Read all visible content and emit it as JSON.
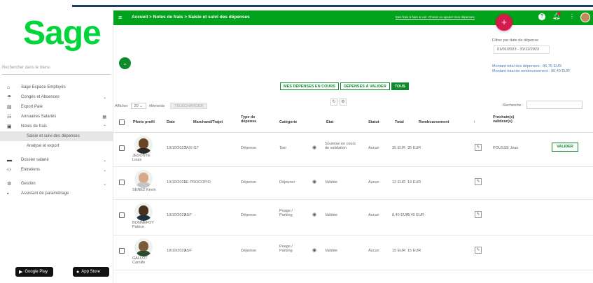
{
  "sidebar": {
    "logo": "Sage",
    "search_placeholder": "Rechercher dans le menu",
    "items": [
      {
        "label": "Sage Espace Employés",
        "icon": "home-icon",
        "glyph": "⌂",
        "chevron": ""
      },
      {
        "label": "Congés et Absences",
        "icon": "beach-icon",
        "glyph": "☂",
        "chevron": "⌄"
      },
      {
        "label": "Export Paie",
        "icon": "document-icon",
        "glyph": "▤",
        "chevron": ""
      },
      {
        "label": "Annuaires Salariés",
        "icon": "people-icon",
        "glyph": "☷",
        "chevron": "▦"
      },
      {
        "label": "Notes de frais",
        "icon": "receipt-icon",
        "glyph": "▣",
        "chevron": "⌃"
      },
      {
        "label": "Saisie et suivi des dépenses",
        "icon": "",
        "glyph": "",
        "chevron": ""
      },
      {
        "label": "Analyse et export",
        "icon": "",
        "glyph": "",
        "chevron": ""
      },
      {
        "label": "Dossier salarié",
        "icon": "folder-icon",
        "glyph": "▬",
        "chevron": "⌄"
      },
      {
        "label": "Entretiens",
        "icon": "handshake-icon",
        "glyph": "⚇",
        "chevron": "⌄"
      },
      {
        "label": "Gestion",
        "icon": "gear-icon",
        "glyph": "⚙",
        "chevron": "⌄"
      },
      {
        "label": "Assistant de paramétrage",
        "icon": "wizard-icon",
        "glyph": "▪",
        "chevron": ""
      }
    ],
    "stores": {
      "google": "Google Play",
      "apple": "App Store"
    }
  },
  "topbar": {
    "breadcrumb": "Accueil > Notes de frais > Saisie et suivi des dépenses",
    "link": "Mes frais à faire & voir. Choisir ou ajouter mes dépenses",
    "plus": "+",
    "help": "?",
    "kebab": "⋮"
  },
  "filters": {
    "date_label": "Filtrer par date de dépense",
    "date_value": "01/01/2023 - 31/12/2023",
    "total_expenses": "Montant total des dépenses : 86,75 EUR",
    "total_refund": "Montant total de remboursement : 86,40 EUR"
  },
  "tabs": [
    "MES DÉPENSES EN COURS",
    "DÉPENSES À VALIDER",
    "TOUS"
  ],
  "active_tab": 2,
  "table_tools": {
    "show_label": "Afficher",
    "show_value": "20",
    "elements_label": "éléments",
    "export_label": "TÉLÉCHARGER",
    "search_label": "Recherche :"
  },
  "columns": {
    "photo": "Photo profil",
    "date": "Date",
    "merchant": "Marchand/Trajet",
    "type": "Type de dépense",
    "category": "Catégorie",
    "state": "Etat",
    "status": "Statut",
    "total": "Total",
    "refund": "Remboursement",
    "next": "Prochain(s) valideur(s)"
  },
  "rows": [
    {
      "name": "JEDONTE Louis",
      "date": "19/10/2023",
      "merchant": "TAXI G7",
      "type": "Dépense",
      "category": "Taxi",
      "state": "Soumise en cours de validation",
      "status": "Aucun",
      "total": "35 EUR",
      "refund": "35 EUR",
      "next": "POUSSE Jean",
      "action": "VALIDER",
      "skin": "#6b4423",
      "shirt": "#2a2a2a"
    },
    {
      "name": "SENEZ Kevin",
      "date": "10/10/2023",
      "merchant": "LE PROCOPIO",
      "type": "Dépense",
      "category": "Déjeuner",
      "state": "Validée",
      "status": "Aucun",
      "total": "13 EUR",
      "refund": "13 EUR",
      "next": "",
      "action": "",
      "skin": "#d9a98a",
      "shirt": "#c4c4c4"
    },
    {
      "name": "BONNEFOY Patrice",
      "date": "10/10/2023",
      "merchant": "ASF",
      "type": "Dépense",
      "category": "Peage / Parking",
      "state": "Validée",
      "status": "Aucun",
      "total": "8,40 EUR",
      "refund": "8,40 EUR",
      "next": "",
      "action": "",
      "skin": "#4a3020",
      "shirt": "#1f3140"
    },
    {
      "name": "GALLOT Camille",
      "date": "18/10/2023",
      "merchant": "ASF",
      "type": "Dépense",
      "category": "Peage / Parking",
      "state": "Validée",
      "status": "Aucun",
      "total": "15 EUR",
      "refund": "15 EUR",
      "next": "",
      "action": "",
      "skin": "#7a5a3a",
      "shirt": "#2e4a2e"
    }
  ],
  "colors": {
    "brand": "#00a31b",
    "accent": "#d61b4b",
    "tab": "#0f8a2b"
  }
}
